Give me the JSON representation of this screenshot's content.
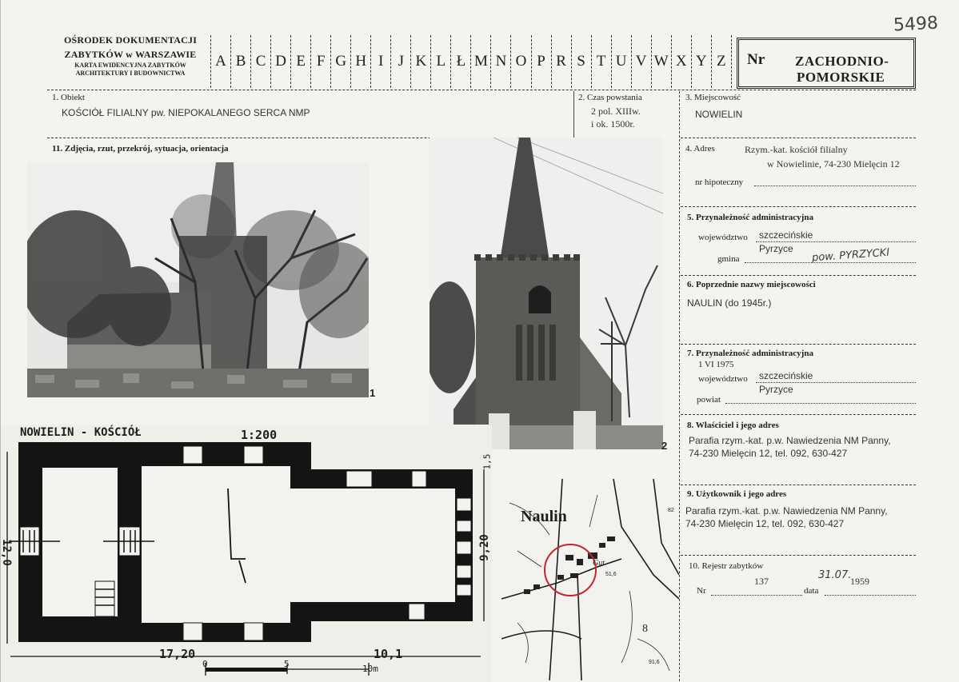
{
  "header": {
    "institution": [
      "OŚRODEK DOKUMENTACJI",
      "ZABYTKÓW w WARSZAWIE",
      "KARTA EWIDENCYJNA ZABYTKÓW",
      "ARCHITEKTURY I BUDOWNICTWA"
    ],
    "letters": [
      "A",
      "B",
      "C",
      "D",
      "E",
      "F",
      "G",
      "H",
      "I",
      "J",
      "K",
      "L",
      "Ł",
      "M",
      "N",
      "O",
      "P",
      "R",
      "S",
      "T",
      "U",
      "V",
      "W",
      "X",
      "Y",
      "Z"
    ],
    "nr_label": "Nr",
    "region": [
      "ZACHODNIO-",
      "POMORSKIE"
    ],
    "handwritten_number": "5498"
  },
  "fields": {
    "obiekt_label": "1. Obiekt",
    "obiekt_value": "KOŚCIÓŁ FILIALNY pw. NIEPOKALANEGO SERCA NMP",
    "czas_label": "2. Czas powstania",
    "czas_value": [
      "2 pol. XIIIw.",
      "i ok. 1500r."
    ],
    "miejscowosc_label": "3. Miejscowość",
    "miejscowosc_value": "NOWIELIN",
    "adres_label": "4. Adres",
    "adres_value": [
      "Rzym.-kat. kościół filialny",
      "w Nowielinie, 74-230 Mielęcin 12"
    ],
    "nr_hipoteczny_label": "nr hipoteczny",
    "przynaleznosc_label": "5. Przynależność administracyjna",
    "wojewodztwo_label": "województwo",
    "wojewodztwo_value": "szczecińskie",
    "gmina_label": "gmina",
    "gmina_value": "Pyrzyce",
    "gmina_handwritten": "pow. PYRZYCKI",
    "poprzednie_label": "6. Poprzednie nazwy miejscowości",
    "poprzednie_value": "NAULIN (do 1945r.)",
    "przynaleznosc75_label": [
      "7. Przynależność administracyjna",
      "1 VI 1975"
    ],
    "wojewodztwo75_label": "województwo",
    "wojewodztwo75_value": "szczecińskie",
    "powiat_label": "powiat",
    "powiat_value": "Pyrzyce",
    "wlasciciel_label": "8. Właściciel i jego adres",
    "wlasciciel_value": [
      "Parafia rzym.-kat. p.w. Nawiedzenia NM Panny,",
      "74-230 Mielęcin 12, tel. 092, 630-427"
    ],
    "uzytkownik_label": "9. Użytkownik i jego adres",
    "uzytkownik_value": [
      "Parafia rzym.-kat. p.w. Nawiedzenia NM Panny,",
      "74-230 Mielęcin 12, tel. 092, 630-427"
    ],
    "rejestr_label": "10. Rejestr zabytków",
    "rejestr_nr_label": "Nr",
    "rejestr_nr_value": "137",
    "rejestr_data_label": "data",
    "rejestr_data_value": "1959",
    "rejestr_data_handwritten": "31.07.",
    "zdjecia_label": "11. Zdjęcia, rzut, przekrój, sytuacja, orientacja"
  },
  "photos": {
    "photo1_number": "1",
    "photo2_number": "2"
  },
  "plan": {
    "title": "NOWIELIN - KOŚCIÓŁ",
    "scale": "1:200",
    "dim_left": "12,0",
    "dim_right": "9,20",
    "dim_right_small": "1,5",
    "dim_bottom_1": "17,20",
    "dim_bottom_2": "10,1",
    "scalebar": [
      "0",
      "5",
      "10m"
    ]
  },
  "map": {
    "place_name": "Naulin",
    "labels": [
      "Gut",
      "51,6",
      "82",
      "8",
      "91,6"
    ]
  },
  "colors": {
    "paper": "#f4f3ef",
    "ink": "#1e1e1e",
    "circle": "#c0282d"
  }
}
